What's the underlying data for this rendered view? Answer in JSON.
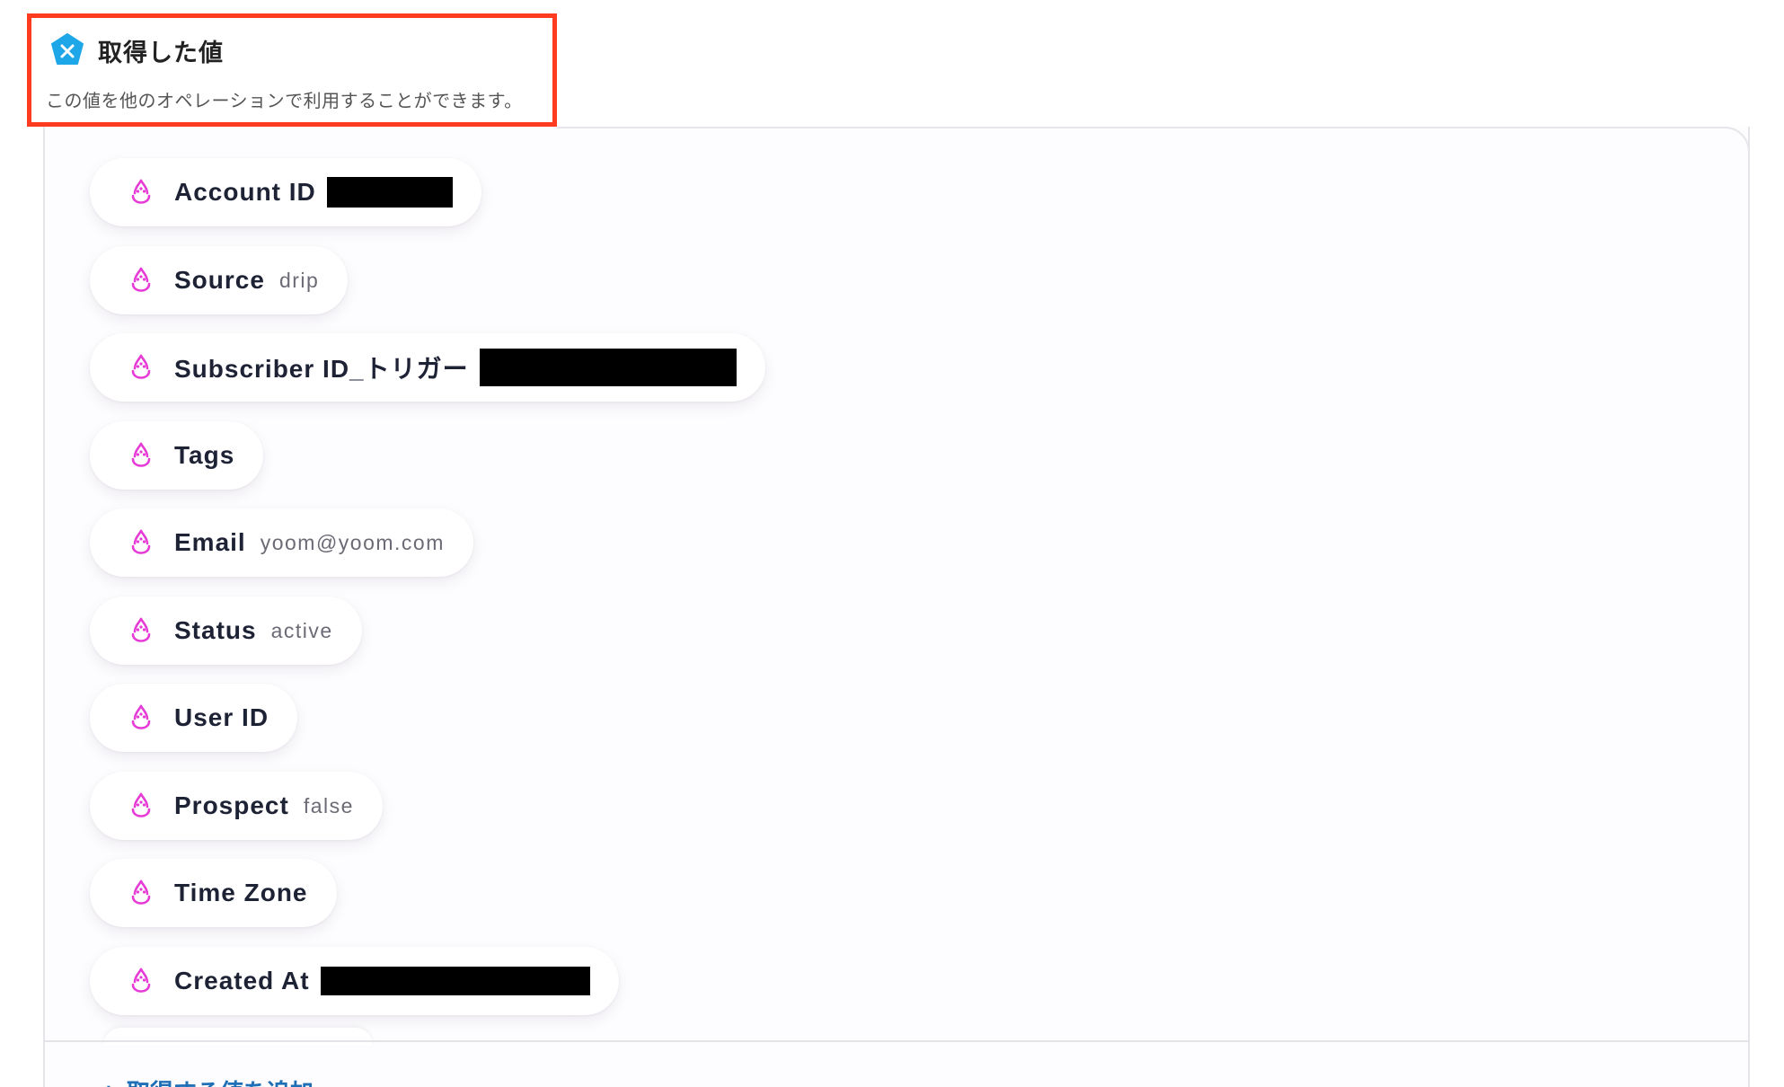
{
  "header": {
    "icon": "x-variable-icon",
    "title": "取得した値",
    "description": "この値を他のオペレーションで利用することができます。"
  },
  "colors": {
    "highlight_border": "#ff3b1f",
    "brand_blue": "#1ea7e8",
    "drop_pink": "#e63bd6",
    "link_blue": "#1f6fb6"
  },
  "fields": [
    {
      "label": "Account ID",
      "value": "",
      "redacted": true
    },
    {
      "label": "Source",
      "value": "drip",
      "redacted": false
    },
    {
      "label": "Subscriber ID_トリガー",
      "value": "",
      "redacted": true
    },
    {
      "label": "Tags",
      "value": "",
      "redacted": false
    },
    {
      "label": "Email",
      "value": "yoom@yoom.com",
      "redacted": false
    },
    {
      "label": "Status",
      "value": "active",
      "redacted": false
    },
    {
      "label": "User ID",
      "value": "",
      "redacted": false
    },
    {
      "label": "Prospect",
      "value": "false",
      "redacted": false
    },
    {
      "label": "Time Zone",
      "value": "",
      "redacted": false
    },
    {
      "label": "Created At",
      "value": "",
      "redacted": true
    }
  ],
  "footer": {
    "add_link_label": "+ 取得する値を追加"
  }
}
